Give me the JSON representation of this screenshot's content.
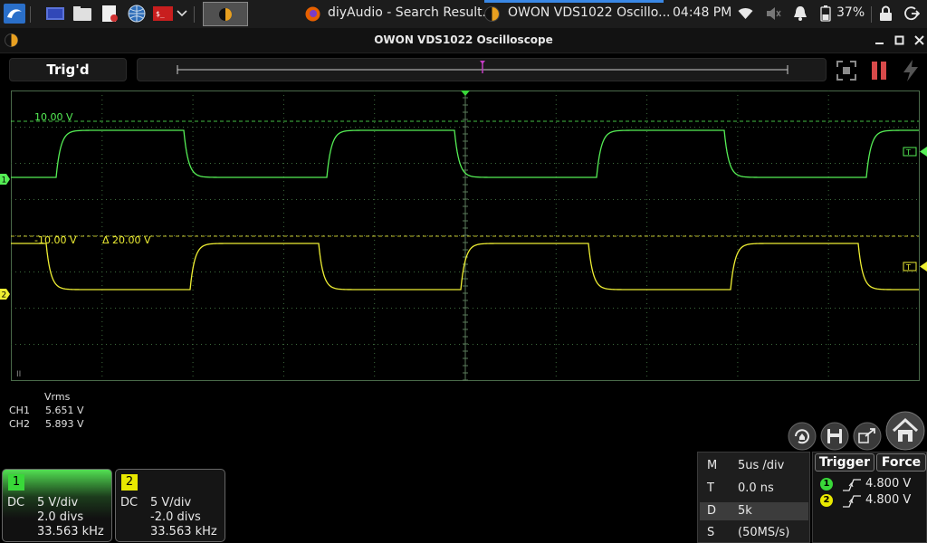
{
  "taskbar": {
    "tabs": [
      {
        "label": "diyAudio - Search Result..."
      },
      {
        "label": "OWON VDS1022 Oscillo..."
      }
    ],
    "clock": "04:48 PM",
    "battery": "37%"
  },
  "window": {
    "title": "OWON VDS1022 Oscilloscope"
  },
  "toolbar": {
    "status": "Trig'd"
  },
  "waveform": {
    "ch1_color": "#55ee55",
    "ch2_color": "#eeee33",
    "ch1_marker": "1",
    "ch2_marker": "2",
    "ch1_level_label": "10.00 V",
    "ch2_level_label": "-10.00 V",
    "delta_label": "Δ 20.00 V",
    "trigger_tag": "T",
    "corner_label": "II"
  },
  "measurements": {
    "header": "Vrms",
    "rows": [
      {
        "channel": "CH1",
        "value": "5.651 V"
      },
      {
        "channel": "CH2",
        "value": "5.893 V"
      }
    ]
  },
  "channels": [
    {
      "num": "1",
      "coupling": "DC",
      "scale": "5 V/div",
      "offset": "2.0 divs",
      "freq": "33.563 kHz",
      "color": "#39d839"
    },
    {
      "num": "2",
      "coupling": "DC",
      "scale": "5 V/div",
      "offset": "-2.0 divs",
      "freq": "33.563 kHz",
      "color": "#e8e800"
    }
  ],
  "timebase": {
    "rows": [
      {
        "key": "M",
        "value": "5us /div"
      },
      {
        "key": "T",
        "value": "0.0 ns"
      },
      {
        "key": "D",
        "value": "5k"
      },
      {
        "key": "S",
        "value": "(50MS/s)"
      }
    ]
  },
  "trigger": {
    "trigger_label": "Trigger",
    "force_label": "Force",
    "rows": [
      {
        "num": "1",
        "value": "4.800 V",
        "color": "#39d839"
      },
      {
        "num": "2",
        "value": "4.800 V",
        "color": "#e8e800"
      }
    ]
  }
}
